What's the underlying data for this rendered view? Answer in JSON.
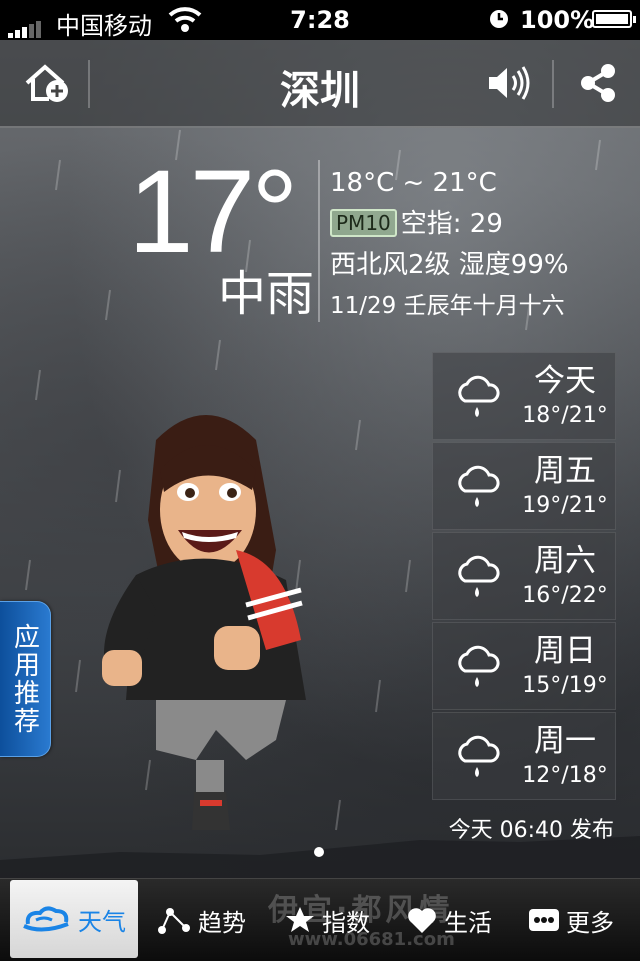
{
  "status_bar": {
    "carrier": "中国移动",
    "time": "7:28",
    "battery": "100%"
  },
  "nav": {
    "city": "深圳",
    "icons": [
      "home-add-icon",
      "speaker-icon",
      "share-icon"
    ]
  },
  "current": {
    "temperature": "17°",
    "condition": "中雨",
    "range": "18°C ~ 21°C",
    "pm_badge": "PM10",
    "air_index": "空指: 29",
    "wind_humidity": "西北风2级 湿度99%",
    "date": "11/29 壬辰年十月十六"
  },
  "forecast": [
    {
      "day": "今天",
      "range": "18°/21°",
      "icon": "rain-cloud-icon"
    },
    {
      "day": "周五",
      "range": "19°/21°",
      "icon": "rain-cloud-icon"
    },
    {
      "day": "周六",
      "range": "16°/22°",
      "icon": "rain-cloud-icon"
    },
    {
      "day": "周日",
      "range": "15°/19°",
      "icon": "rain-cloud-icon"
    },
    {
      "day": "周一",
      "range": "12°/18°",
      "icon": "rain-cloud-icon"
    }
  ],
  "publish_time": "今天 06:40 发布",
  "side_tab": "应用推荐",
  "tabs": [
    {
      "label": "天气",
      "icon": "cloud-logo-icon",
      "active": true
    },
    {
      "label": "趋势",
      "icon": "trend-icon"
    },
    {
      "label": "指数",
      "icon": "star-icon"
    },
    {
      "label": "生活",
      "icon": "heart-icon"
    },
    {
      "label": "更多",
      "icon": "more-icon"
    }
  ],
  "watermark": {
    "line1": "伊宜·都风情",
    "line2": "www.06681.com"
  },
  "colors": {
    "accent": "#1a84e6",
    "side_tab": "#1a5fb0",
    "pm_badge": "#aad2a0"
  }
}
